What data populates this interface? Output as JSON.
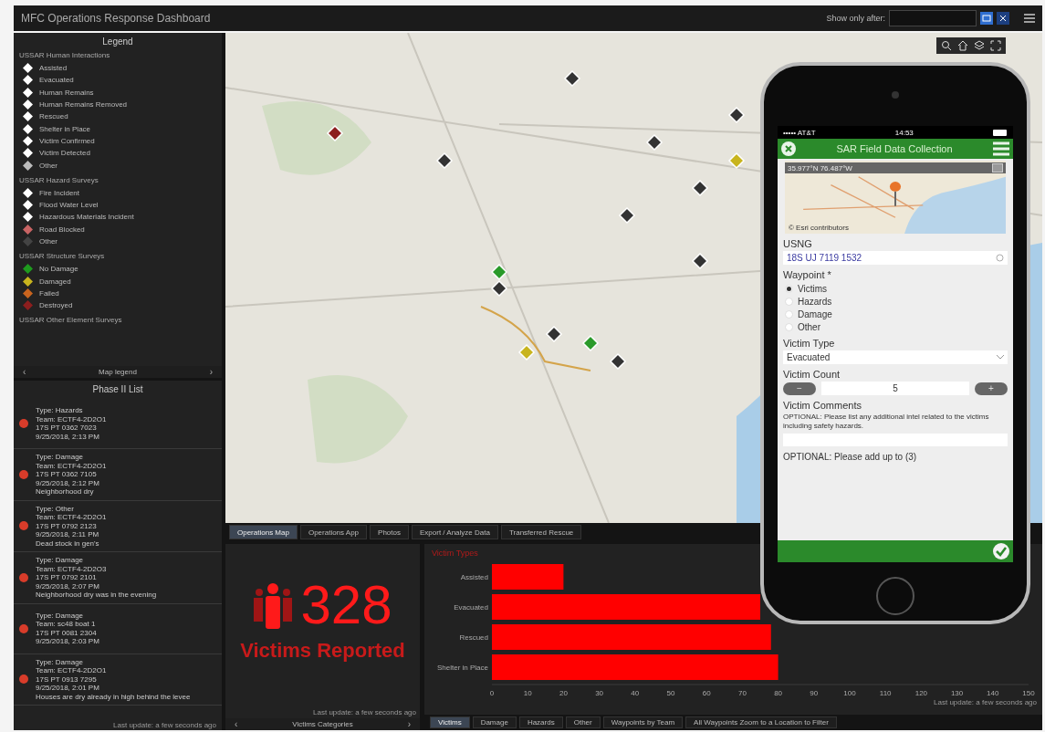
{
  "header": {
    "title": "MFC Operations Response Dashboard",
    "filter_label": "Show only after:"
  },
  "legend": {
    "title": "Legend",
    "groups": [
      {
        "title": "USSAR Human Interactions",
        "items": [
          {
            "label": "Assisted",
            "color": "#ffffff"
          },
          {
            "label": "Evacuated",
            "color": "#ffffff"
          },
          {
            "label": "Human Remains",
            "color": "#ffffff"
          },
          {
            "label": "Human Remains Removed",
            "color": "#ffffff"
          },
          {
            "label": "Rescued",
            "color": "#ffffff"
          },
          {
            "label": "Shelter in Place",
            "color": "#ffffff"
          },
          {
            "label": "Victim Confirmed",
            "color": "#ffffff"
          },
          {
            "label": "Victim Detected",
            "color": "#ffffff"
          },
          {
            "label": "Other",
            "color": "#bbbbbb"
          }
        ]
      },
      {
        "title": "USSAR Hazard Surveys",
        "items": [
          {
            "label": "Fire Incident",
            "color": "#ffffff"
          },
          {
            "label": "Flood Water Level",
            "color": "#ffffff"
          },
          {
            "label": "Hazardous Materials Incident",
            "color": "#ffffff"
          },
          {
            "label": "Road Blocked",
            "color": "#c86464"
          },
          {
            "label": "Other",
            "color": "#444444"
          }
        ]
      },
      {
        "title": "USSAR Structure Surveys",
        "items": [
          {
            "label": "No Damage",
            "color": "#1e9a1e"
          },
          {
            "label": "Damaged",
            "color": "#c8b41e"
          },
          {
            "label": "Failed",
            "color": "#c8641e"
          },
          {
            "label": "Destroyed",
            "color": "#8c1e1e"
          }
        ]
      },
      {
        "title": "USSAR Other Element Surveys"
      }
    ],
    "footer": {
      "prev": "‹",
      "label": "Map legend",
      "next": "›"
    }
  },
  "phase_list": {
    "title": "Phase II List",
    "items": [
      {
        "lines": [
          "Type: Hazards",
          "Team: ECTF4-2D2O1",
          "17S PT 0362 7023",
          "9/25/2018, 2:13 PM"
        ]
      },
      {
        "lines": [
          "Type: Damage",
          "Team: ECTF4-2D2O1",
          "17S PT 0362 7105",
          "9/25/2018, 2:12 PM",
          "Neighborhood dry"
        ]
      },
      {
        "lines": [
          "Type: Other",
          "Team: ECTF4-2D2O1",
          "17S PT 0792 2123",
          "9/25/2018, 2:11 PM",
          "Dead stock in gen's"
        ]
      },
      {
        "lines": [
          "Type: Damage",
          "Team: ECTF4-2D2O3",
          "17S PT 0792 2101",
          "9/25/2018, 2:07 PM",
          "Neighborhood dry was in the evening"
        ]
      },
      {
        "lines": [
          "Type: Damage",
          "Team: sc48 boat 1",
          "17S PT 0081 2304",
          "9/25/2018, 2:03 PM"
        ]
      },
      {
        "lines": [
          "Type: Damage",
          "Team: ECTF4-2D2O1",
          "17S PT 0913 7295",
          "9/25/2018, 2:01 PM",
          "Houses are dry already in high behind the levee"
        ]
      }
    ],
    "updated": "Last update: a few seconds ago"
  },
  "map_tabs": [
    {
      "label": "Operations Map",
      "selected": true
    },
    {
      "label": "Operations App",
      "selected": false
    },
    {
      "label": "Photos",
      "selected": false
    },
    {
      "label": "Export / Analyze Data",
      "selected": false
    },
    {
      "label": "Transferred Rescue",
      "selected": false
    }
  ],
  "indicator": {
    "value": "328",
    "label": "Victims Reported",
    "updated": "Last update: a few seconds ago",
    "footer": {
      "prev": "‹",
      "label": "Victims Categories",
      "next": "›"
    }
  },
  "chart_panel": {
    "updated": "Last update: a few seconds ago",
    "chart_data": {
      "type": "bar",
      "orientation": "horizontal",
      "title": "Victim Types",
      "categories": [
        "Assisted",
        "Evacuated",
        "Rescued",
        "Shelter in Place"
      ],
      "series": [
        {
          "color": "#ff0000",
          "values": [
            20,
            75,
            78,
            80
          ]
        }
      ],
      "xlim": [
        0,
        150
      ],
      "xticks": [
        0,
        10,
        20,
        30,
        40,
        50,
        60,
        70,
        80,
        90,
        100,
        110,
        120,
        130,
        140,
        150
      ]
    },
    "tabs": [
      {
        "label": "Victims",
        "selected": true
      },
      {
        "label": "Damage",
        "selected": false
      },
      {
        "label": "Hazards",
        "selected": false
      },
      {
        "label": "Other",
        "selected": false
      },
      {
        "label": "Waypoints by Team",
        "selected": false
      },
      {
        "label": "All Waypoints Zoom to a Location to Filter",
        "selected": false
      }
    ]
  },
  "phone": {
    "carrier": "••••• AT&T",
    "time": "14:53",
    "title": "SAR Field Data Collection",
    "coords": "35.977°N 76.487°W",
    "map_credit": "© Esri contributors",
    "usng": {
      "label": "USNG",
      "value": "18S UJ 7119 1532"
    },
    "waypoint": {
      "label": "Waypoint *",
      "options": [
        {
          "label": "Victims",
          "selected": true
        },
        {
          "label": "Hazards",
          "selected": false
        },
        {
          "label": "Damage",
          "selected": false
        },
        {
          "label": "Other",
          "selected": false
        }
      ]
    },
    "victim_type": {
      "label": "Victim Type",
      "value": "Evacuated"
    },
    "victim_count": {
      "label": "Victim Count",
      "value": "5",
      "minus": "−",
      "plus": "+"
    },
    "comments": {
      "label": "Victim Comments",
      "hint": "OPTIONAL: Please list any additional intel related to the victims including safety hazards."
    },
    "note": "OPTIONAL: Please add up to (3)"
  }
}
